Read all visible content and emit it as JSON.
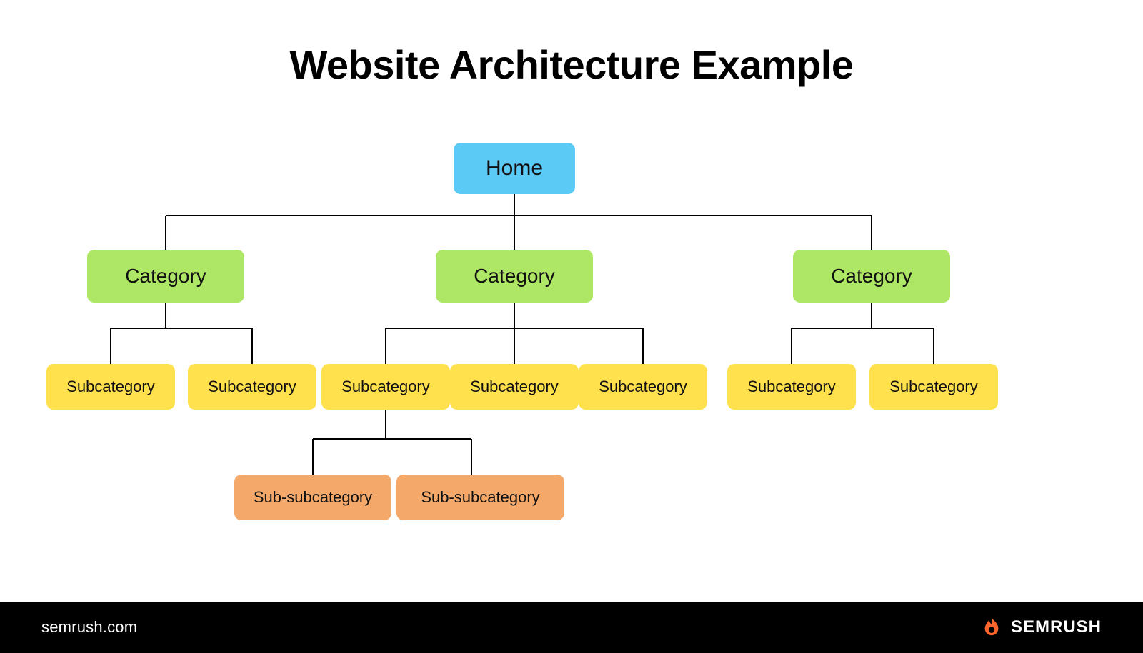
{
  "title": "Website Architecture Example",
  "colors": {
    "home": "#5bcaf5",
    "category": "#aee665",
    "subcategory": "#ffe14d",
    "subsub": "#f4a86a",
    "footer_bg": "#000000",
    "footer_text": "#ffffff",
    "brand_accent": "#ff642d"
  },
  "nodes": {
    "home": "Home",
    "categories": [
      "Category",
      "Category",
      "Category"
    ],
    "subcategories": {
      "group1": [
        "Subcategory",
        "Subcategory"
      ],
      "group2": [
        "Subcategory",
        "Subcategory",
        "Subcategory"
      ],
      "group3": [
        "Subcategory",
        "Subcategory"
      ]
    },
    "subsubcategories": [
      "Sub-subcategory",
      "Sub-subcategory"
    ]
  },
  "footer": {
    "site": "semrush.com",
    "brand": "SEMRUSH"
  }
}
